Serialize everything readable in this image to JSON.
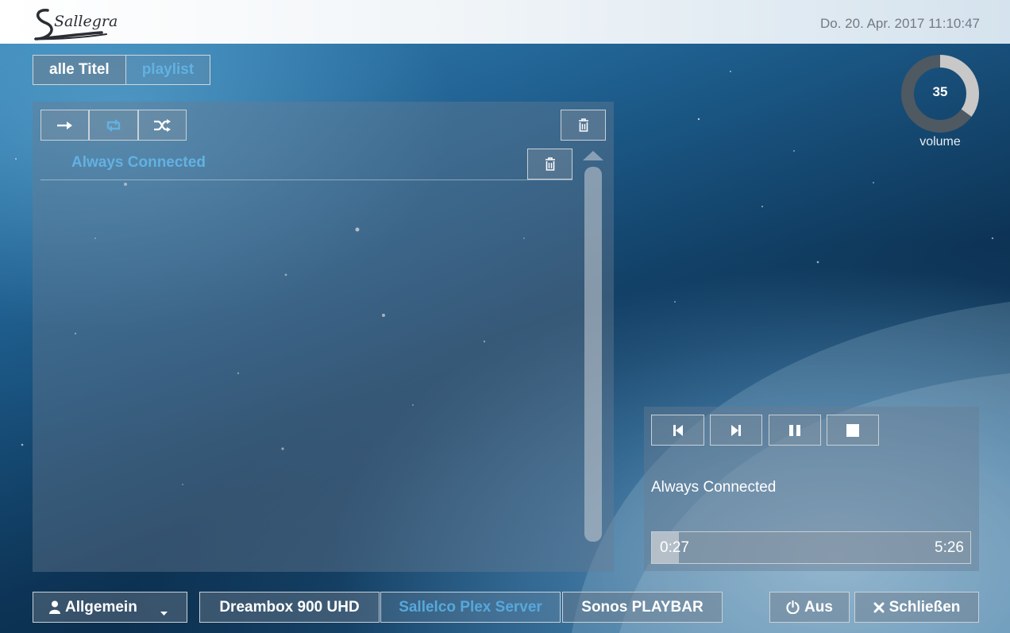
{
  "header": {
    "logo_text": "Sallegra",
    "datetime": "Do. 20. Apr. 2017 11:10:47"
  },
  "tabs": [
    {
      "label": "alle Titel",
      "active": true
    },
    {
      "label": "playlist",
      "active": false
    }
  ],
  "playlist_toolbar": {
    "buttons": [
      {
        "name": "repeat-off",
        "icon": "arrow-right-icon"
      },
      {
        "name": "repeat-all",
        "icon": "retweet-icon",
        "active": true
      },
      {
        "name": "shuffle",
        "icon": "random-icon"
      }
    ],
    "clear_icon": "trash-icon"
  },
  "playlist": {
    "items": [
      {
        "title": "Always Connected",
        "delete_icon": "trash-icon"
      }
    ]
  },
  "volume": {
    "value": 35,
    "label": "volume",
    "ring_color": "#c8c8c8",
    "track_color": "#4f5962"
  },
  "player": {
    "controls": [
      "previous-icon",
      "next-icon",
      "pause-icon",
      "stop-icon"
    ],
    "track_title": "Always Connected",
    "current_time": "0:27",
    "total_time": "5:26",
    "progress_fraction": 0.084
  },
  "footer": {
    "room": {
      "label": "Allgemein",
      "icon": "user-icon"
    },
    "devices": [
      {
        "label": "Dreambox 900 UHD",
        "active": false
      },
      {
        "label": "Sallelco Plex Server",
        "active": true
      },
      {
        "label": "Sonos PLAYBAR",
        "active": false
      }
    ],
    "power_label": "Aus",
    "close_label": "Schließen"
  },
  "colors": {
    "accent": "#62b1e2",
    "panel": "rgba(105,125,145,0.42)"
  }
}
